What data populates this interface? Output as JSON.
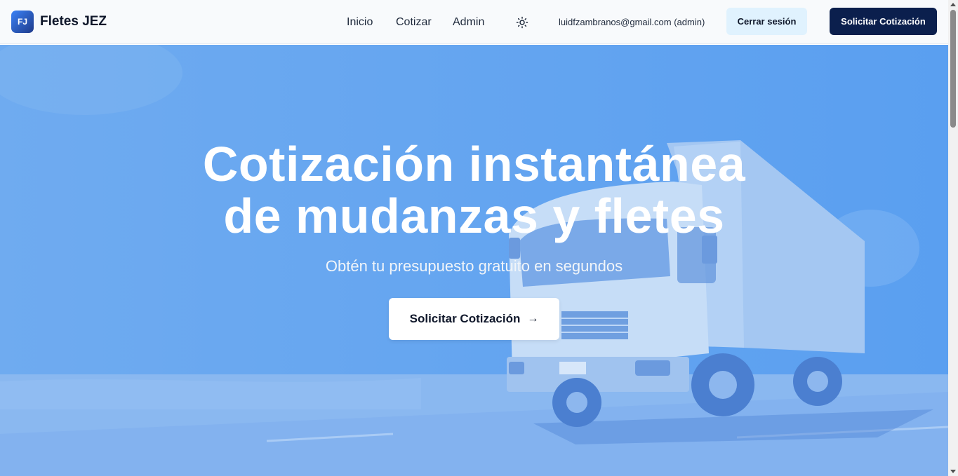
{
  "header": {
    "logo_initials": "FJ",
    "brand": "Fletes JEZ",
    "nav": [
      {
        "label": "Inicio"
      },
      {
        "label": "Cotizar"
      },
      {
        "label": "Admin"
      }
    ],
    "theme_icon": "sun-icon",
    "user_email": "luidfzambranos@gmail.com (admin)",
    "logout_label": "Cerrar sesión",
    "cta_label": "Solicitar Cotización"
  },
  "hero": {
    "title_line1": "Cotización instantánea",
    "title_line2": "de mudanzas y fletes",
    "subtitle": "Obtén tu presupuesto gratuito en segundos",
    "button_label": "Solicitar Cotización",
    "button_icon": "arrow-right-icon",
    "background_image": "truck-on-road-image"
  },
  "colors": {
    "primary_dark": "#0b1f4d",
    "hero_overlay": "#6aa8ef",
    "logout_bg": "#e0f2fe"
  }
}
